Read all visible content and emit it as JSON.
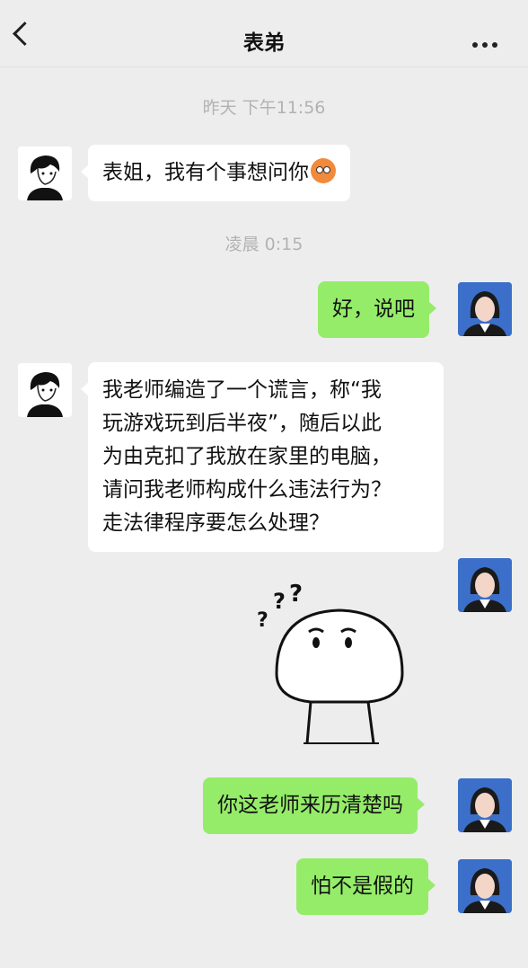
{
  "header": {
    "title": "表弟"
  },
  "icons": {
    "back": "chevron-left-icon",
    "more": "more-dots-icon",
    "emoji": "face-with-tears-emoji",
    "sticker": "confused-mushroom-sticker"
  },
  "colors": {
    "background": "#ededed",
    "incoming_bubble": "#ffffff",
    "outgoing_bubble": "#95ec69",
    "timestamp": "#b2b2b2"
  },
  "timestamps": [
    "昨天 下午11:56",
    "凌晨 0:15"
  ],
  "messages": [
    {
      "from": "left",
      "text": "表姐，我有个事想问你"
    },
    {
      "from": "right",
      "text": "好，说吧"
    },
    {
      "from": "left",
      "lines": [
        "我老师编造了一个谎言，称“我",
        "玩游戏玩到后半夜”，随后以此",
        "为由克扣了我放在家里的电脑，",
        "请问我老师构成什么违法行为？",
        "走法律程序要怎么处理？"
      ]
    },
    {
      "from": "right",
      "text": "你这老师来历清楚吗"
    },
    {
      "from": "right",
      "text": "怕不是假的"
    }
  ]
}
